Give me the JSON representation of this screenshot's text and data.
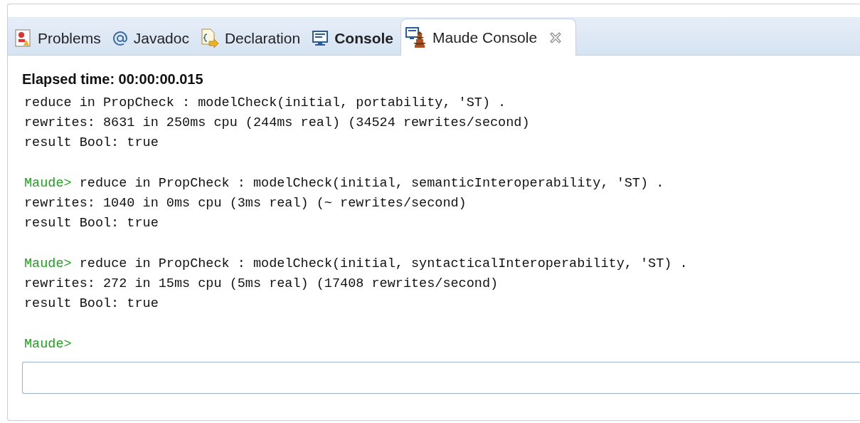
{
  "tabs": [
    {
      "label": "Problems",
      "kind": "problems",
      "selected": false,
      "bold": false,
      "closable": false
    },
    {
      "label": "Javadoc",
      "kind": "javadoc",
      "selected": false,
      "bold": false,
      "closable": false
    },
    {
      "label": "Declaration",
      "kind": "declaration",
      "selected": false,
      "bold": false,
      "closable": false
    },
    {
      "label": "Console",
      "kind": "console",
      "selected": false,
      "bold": true,
      "closable": false
    },
    {
      "label": "Maude Console",
      "kind": "maude",
      "selected": true,
      "bold": false,
      "closable": true
    }
  ],
  "console": {
    "heading": "Elapsed time: 00:00:00.015",
    "blocks": [
      {
        "lines": [
          "reduce in PropCheck : modelCheck(initial, portability, 'ST) .",
          "rewrites: 8631 in 250ms cpu (244ms real) (34524 rewrites/second)",
          "result Bool: true"
        ]
      },
      {
        "prompt": "Maude>",
        "lines": [
          "reduce in PropCheck : modelCheck(initial, semanticInteroperability, 'ST) .",
          "rewrites: 1040 in 0ms cpu (3ms real) (~ rewrites/second)",
          "result Bool: true"
        ]
      },
      {
        "prompt": "Maude>",
        "lines": [
          "reduce in PropCheck : modelCheck(initial, syntacticalInteroperability, 'ST) .",
          "rewrites: 272 in 15ms cpu (5ms real) (17408 rewrites/second)",
          "result Bool: true"
        ]
      },
      {
        "prompt": "Maude>"
      }
    ]
  }
}
